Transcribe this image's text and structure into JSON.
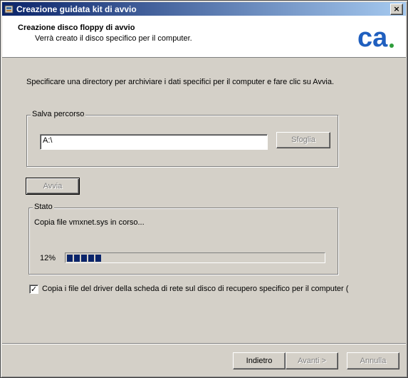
{
  "window": {
    "title": "Creazione guidata kit di avvio",
    "close_label": "×"
  },
  "header": {
    "title": "Creazione disco floppy di avvio",
    "subtitle": "Verrà creato il disco specifico per il computer.",
    "logo_text": "ca",
    "logo_color": "#1f5fbf",
    "logo_dot_color": "#2e9d3b"
  },
  "intro_text": "Specificare una directory per archiviare i dati specifici per il computer e fare clic su Avvia.",
  "save_path": {
    "legend": "Salva percorso",
    "value": "A:\\",
    "browse_label": "Sfoglia"
  },
  "start_button": {
    "label": "Avvia"
  },
  "status": {
    "legend": "Stato",
    "message": "Copia file vmxnet.sys in corso...",
    "percent_label": "12%",
    "progress_fraction": 0.12
  },
  "copy_driver_checkbox": {
    "checked": true,
    "label": "Copia i file del driver della scheda di rete sul disco di recupero specifico per il computer ("
  },
  "footer": {
    "back_label": "Indietro",
    "next_label": "Avanti >",
    "cancel_label": "Annulla"
  },
  "colors": {
    "titlebar_start": "#0a246a",
    "titlebar_end": "#a6caf0",
    "progress_fill": "#0a246a"
  }
}
